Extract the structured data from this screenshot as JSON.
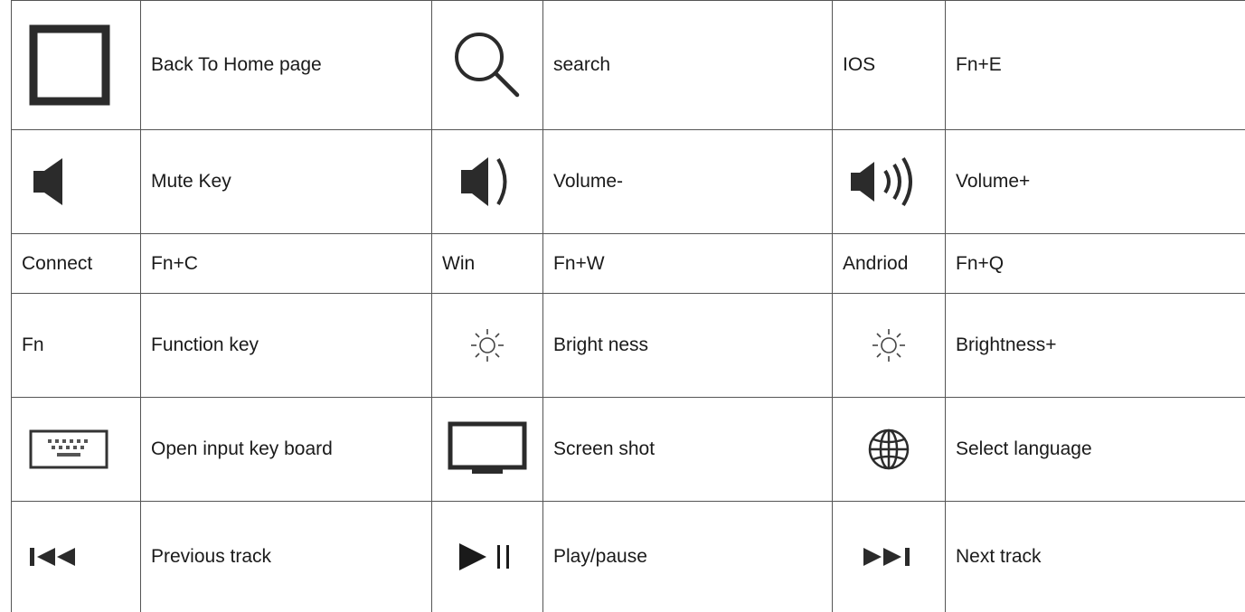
{
  "rows": [
    {
      "c1": {
        "icon": "home-square-icon"
      },
      "c2": "Back To Home page",
      "c3": {
        "icon": "search-icon"
      },
      "c4": "search",
      "c5": "IOS",
      "c6": "Fn+E"
    },
    {
      "c1": {
        "icon": "mute-speaker-icon"
      },
      "c2": "Mute Key",
      "c3": {
        "icon": "volume-down-icon"
      },
      "c4": "Volume-",
      "c5": {
        "icon": "volume-up-icon"
      },
      "c6": "Volume+"
    },
    {
      "c1": "Connect",
      "c2": "Fn+C",
      "c3": "Win",
      "c4": "Fn+W",
      "c5": "Andriod",
      "c6": "Fn+Q"
    },
    {
      "c1": "Fn",
      "c2": "Function key",
      "c3": {
        "icon": "brightness-down-icon"
      },
      "c4": "Bright ness",
      "c5": {
        "icon": "brightness-up-icon"
      },
      "c6": "Brightness+"
    },
    {
      "c1": {
        "icon": "keyboard-icon"
      },
      "c2": "Open input key board",
      "c3": {
        "icon": "monitor-icon"
      },
      "c4": "Screen shot",
      "c5": {
        "icon": "globe-icon"
      },
      "c6": "Select language"
    },
    {
      "c1": {
        "icon": "previous-track-icon"
      },
      "c2": "Previous track",
      "c3": {
        "icon": "play-pause-icon"
      },
      "c4": "Play/pause",
      "c5": {
        "icon": "next-track-icon"
      },
      "c6": "Next track"
    }
  ]
}
